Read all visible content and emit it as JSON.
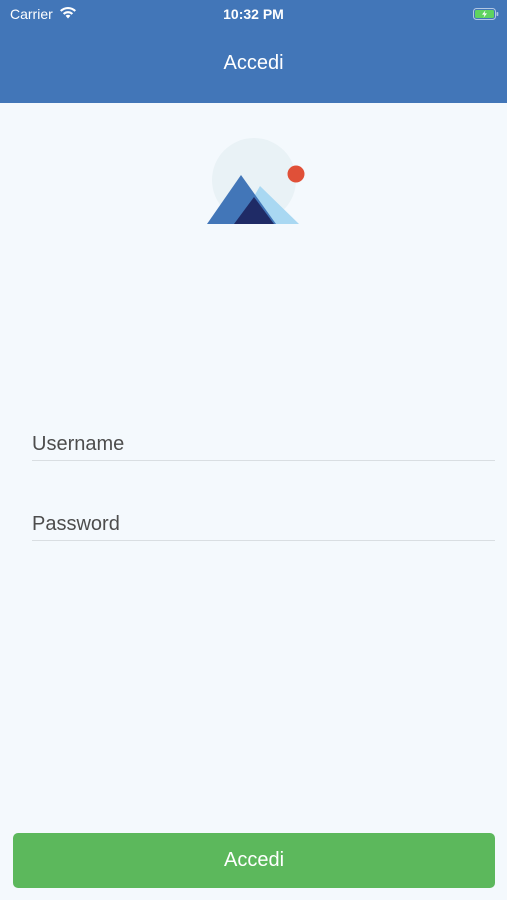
{
  "status_bar": {
    "carrier": "Carrier",
    "time": "10:32 PM"
  },
  "nav": {
    "title": "Accedi"
  },
  "form": {
    "username_placeholder": "Username",
    "password_placeholder": "Password",
    "submit_label": "Accedi"
  },
  "colors": {
    "header": "#4276b8",
    "background": "#f4f9fd",
    "submit": "#5cb85c",
    "logo_sun": "#e05038"
  }
}
